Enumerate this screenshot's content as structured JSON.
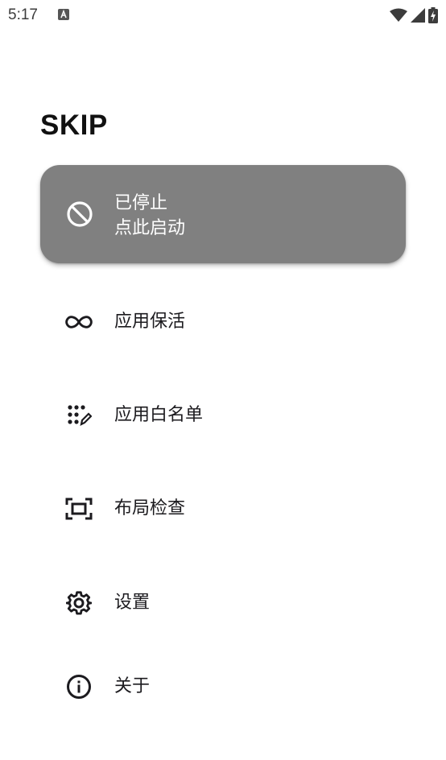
{
  "status_bar": {
    "time": "5:17",
    "notification_icon": "keyboard-a-icon",
    "icons": [
      "wifi-icon",
      "cellular-signal-icon",
      "battery-charging-icon"
    ]
  },
  "app": {
    "title": "SKIP"
  },
  "service_card": {
    "icon": "block-icon",
    "status": "已停止",
    "action_hint": "点此启动",
    "background_color": "#808080"
  },
  "menu": {
    "items": [
      {
        "label": "应用保活",
        "icon": "infinity-icon"
      },
      {
        "label": "应用白名单",
        "icon": "dots-edit-icon"
      },
      {
        "label": "布局检查",
        "icon": "layout-frame-icon"
      },
      {
        "label": "设置",
        "icon": "gear-icon"
      },
      {
        "label": "关于",
        "icon": "info-icon"
      }
    ]
  }
}
